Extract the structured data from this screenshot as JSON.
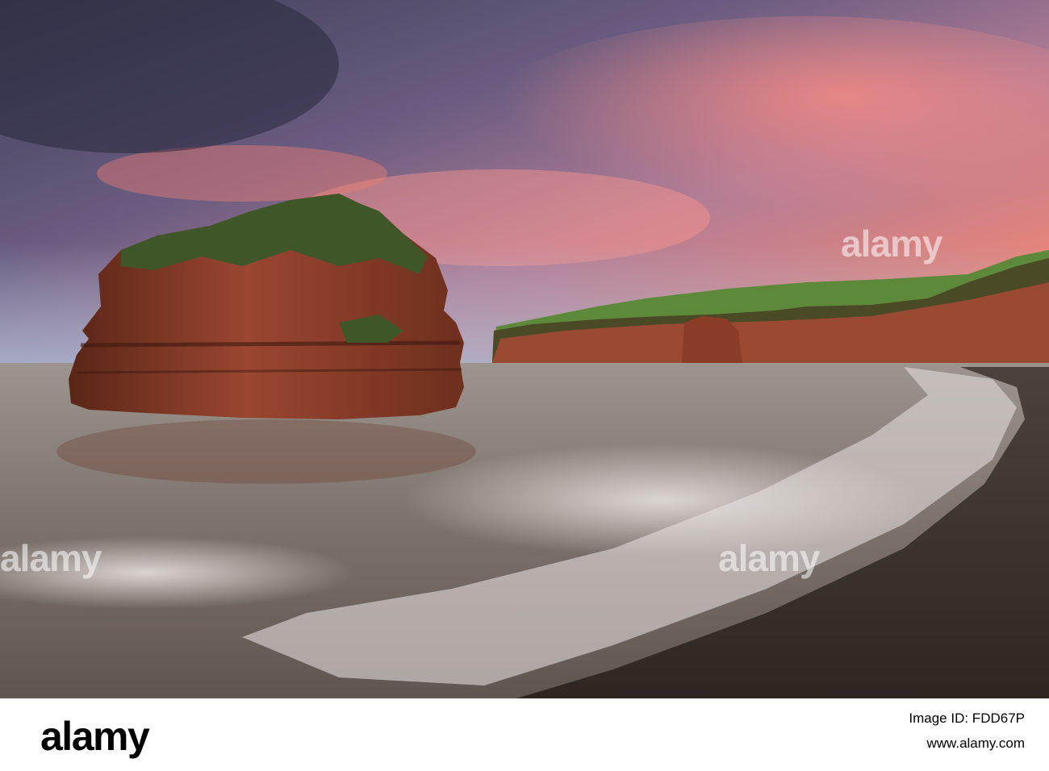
{
  "photo": {
    "subject": "sandstone sea stack at pebble beach at dusk",
    "colors": {
      "sky_top": "#4d4f6a",
      "sky_pink": "#e98478",
      "sky_blue": "#9fb2cf",
      "sea": "#7e736c",
      "rock": "#8b3d26",
      "grass": "#5c8a3a",
      "beach": "#3d3530"
    }
  },
  "watermark": {
    "text": "alamy"
  },
  "footer": {
    "logo": "alamy",
    "image_id_label": "Image ID: FDD67P",
    "url": "www.alamy.com"
  }
}
